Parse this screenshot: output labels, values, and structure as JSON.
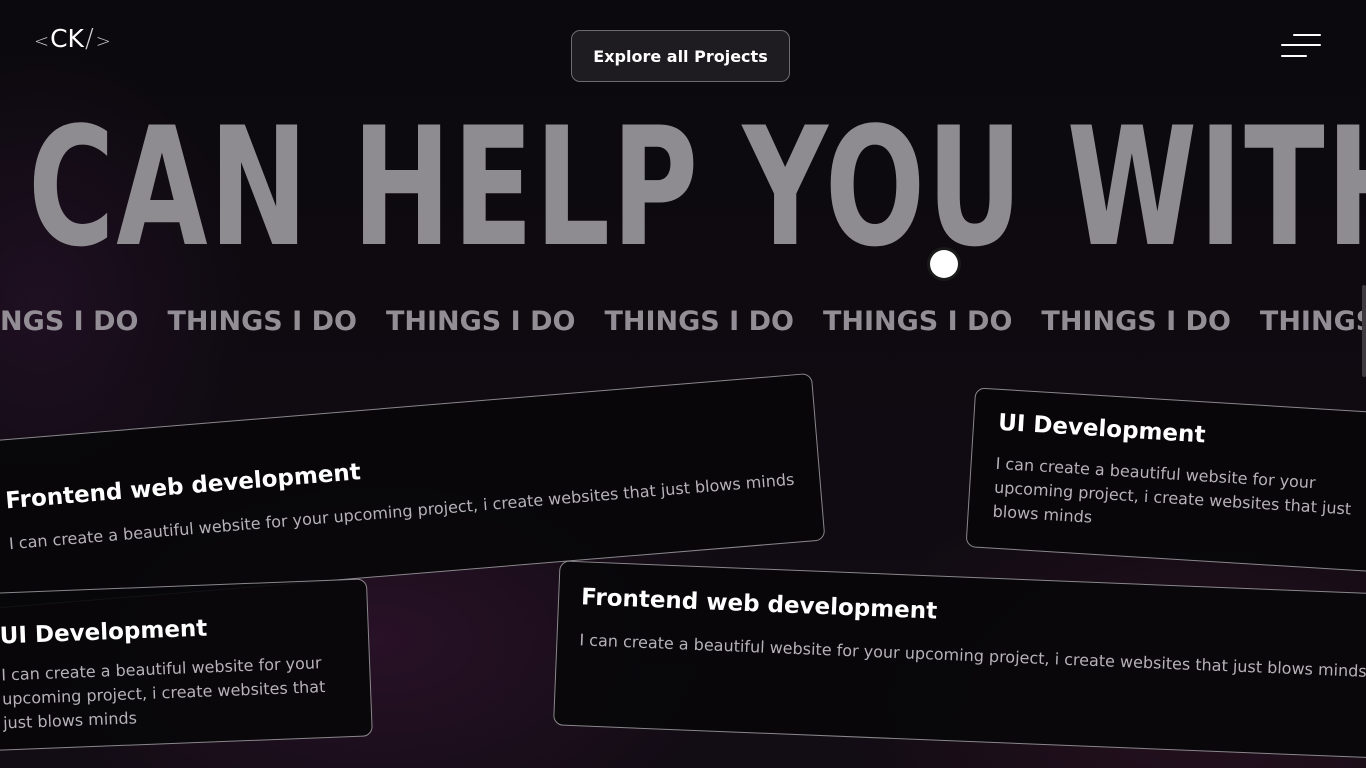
{
  "header": {
    "logo": {
      "open_bracket": "<",
      "text": "CK",
      "slash": "/",
      "close_bracket": ">"
    },
    "explore_button_label": "Explore all Projects",
    "menu_icon": "hamburger-menu-icon"
  },
  "hero": {
    "title": "I CAN HELP YOU WITH"
  },
  "marquee": {
    "items": [
      "THINGS I DO",
      "THINGS I DO",
      "THINGS I DO",
      "THINGS I DO",
      "THINGS I DO",
      "THINGS I DO",
      "THINGS I DO"
    ]
  },
  "cards": [
    {
      "title": "Frontend web development",
      "description": "I can create a beautiful website for your upcoming project, i create websites that just blows minds"
    },
    {
      "title": "UI Development",
      "description": "I can create a beautiful website for your upcoming project, i create websites that just blows minds"
    },
    {
      "title": "UI Development",
      "description": "I can create a beautiful website for your upcoming project, i create websites that just blows minds"
    },
    {
      "title": "Frontend web development",
      "description": "I can create a beautiful website for your upcoming project, i create websites that just blows minds"
    }
  ],
  "colors": {
    "background": "#0c090e",
    "hero_text": "#8f8c91",
    "marquee_text": "#938d96",
    "card_border": "#8a878c",
    "card_desc": "#b6b2b8",
    "accent": "#ffffff"
  }
}
